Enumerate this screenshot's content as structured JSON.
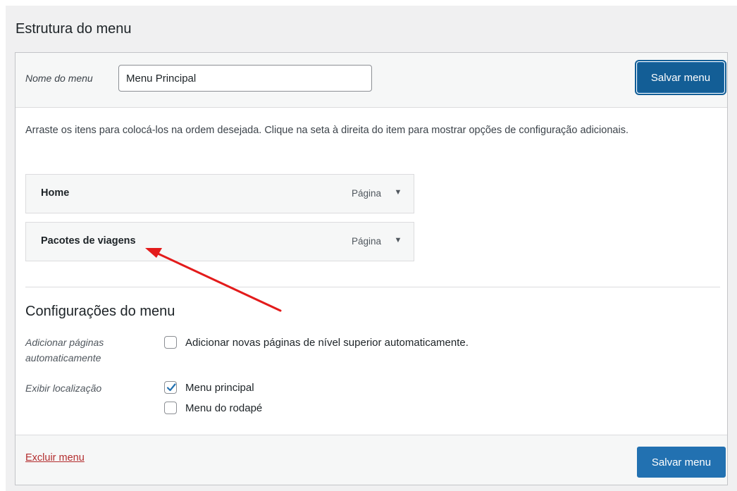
{
  "section_title": "Estrutura do menu",
  "header": {
    "menu_name_label": "Nome do menu",
    "menu_name_value": "Menu Principal",
    "save_label": "Salvar menu"
  },
  "instructions": "Arraste os itens para colocá-los na ordem desejada. Clique na seta à direita do item para mostrar opções de configuração adicionais.",
  "menu_items": [
    {
      "title": "Home",
      "type": "Página",
      "toggle_icon": "▼"
    },
    {
      "title": "Pacotes de viagens",
      "type": "Página",
      "toggle_icon": "▼"
    }
  ],
  "settings": {
    "title": "Configurações do menu",
    "auto_add_label": "Adicionar páginas automaticamente",
    "auto_add_option": "Adicionar novas páginas de nível superior automaticamente.",
    "auto_add_checked": false,
    "location_label": "Exibir localização",
    "locations": [
      {
        "label": "Menu principal",
        "checked": true
      },
      {
        "label": "Menu do rodapé",
        "checked": false
      }
    ]
  },
  "footer": {
    "delete_label": "Excluir menu",
    "save_label": "Salvar menu"
  },
  "colors": {
    "primary": "#2271b1",
    "delete": "#b32d2e",
    "annotation_arrow": "#e31b1b"
  }
}
